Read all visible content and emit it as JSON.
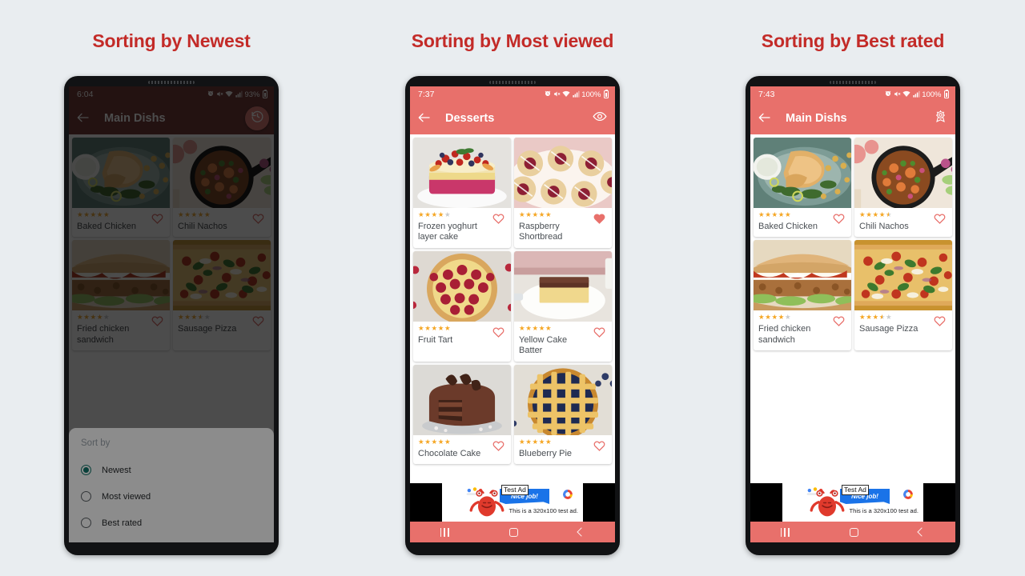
{
  "page": {
    "background": "#e9edf0",
    "heading_color": "#c32b28",
    "accent_coral": "#e8706b",
    "star_color": "#f5a623",
    "heart_color": "#e8706b",
    "radio_selected_color": "#00796b"
  },
  "panels": [
    {
      "caption": "Sorting by Newest",
      "dimmed": true,
      "statusbar": {
        "time": "6:04",
        "icons": [
          "alarm-icon",
          "mute-icon",
          "wifi-icon",
          "signal-icon"
        ],
        "battery": "93%"
      },
      "appbar": {
        "back_icon": "arrow-left-icon",
        "title": "Main Dishs",
        "action_icon": "history-icon",
        "action_is_fab": true
      },
      "cards": [
        {
          "name": "Baked Chicken",
          "rating": 5,
          "favorite": false,
          "image": "baked-chicken-photo"
        },
        {
          "name": "Chili Nachos",
          "rating": 5,
          "favorite": false,
          "image": "chili-nachos-photo"
        },
        {
          "name": "Fried chicken sandwich",
          "rating": 4,
          "favorite": false,
          "image": "fried-chicken-sandwich-photo"
        },
        {
          "name": "Sausage Pizza",
          "rating": 3.5,
          "favorite": false,
          "image": "sausage-pizza-photo"
        }
      ],
      "sheet": {
        "visible": true,
        "title": "Sort by",
        "options": [
          {
            "label": "Newest",
            "selected": true
          },
          {
            "label": "Most viewed",
            "selected": false
          },
          {
            "label": "Best rated",
            "selected": false
          }
        ]
      },
      "ad": {
        "visible": false
      },
      "navbar": {
        "recents_icon": "recents-icon",
        "home_icon": "home-icon",
        "back_icon": "back-icon"
      }
    },
    {
      "caption": "Sorting by Most viewed",
      "dimmed": false,
      "statusbar": {
        "time": "7:37",
        "icons": [
          "alarm-icon",
          "mute-icon",
          "wifi-icon",
          "signal-icon"
        ],
        "battery": "100%"
      },
      "appbar": {
        "back_icon": "arrow-left-icon",
        "title": "Desserts",
        "action_icon": "eye-icon",
        "action_is_fab": false
      },
      "cards": [
        {
          "name": "Frozen yoghurt layer cake",
          "rating": 4,
          "favorite": false,
          "image": "frozen-yoghurt-layer-cake-photo"
        },
        {
          "name": "Raspberry Shortbread",
          "rating": 5,
          "favorite": true,
          "image": "raspberry-shortbread-photo"
        },
        {
          "name": "Fruit Tart",
          "rating": 5,
          "favorite": false,
          "image": "fruit-tart-photo"
        },
        {
          "name": "Yellow Cake Batter",
          "rating": 5,
          "favorite": false,
          "image": "yellow-cake-batter-photo"
        },
        {
          "name": "Chocolate Cake",
          "rating": 5,
          "favorite": false,
          "image": "chocolate-cake-photo"
        },
        {
          "name": "Blueberry Pie",
          "rating": 5,
          "favorite": false,
          "image": "blueberry-pie-photo"
        }
      ],
      "sheet": {
        "visible": false
      },
      "ad": {
        "visible": true,
        "badge": "Test Ad",
        "ribbon": "Nice job!",
        "description": "This is a 320x100 test ad.",
        "logo_icon": "admob-logo-icon",
        "character_icon": "red-monster-icon"
      },
      "navbar": {
        "recents_icon": "recents-icon",
        "home_icon": "home-icon",
        "back_icon": "back-icon"
      }
    },
    {
      "caption": "Sorting by Best rated",
      "dimmed": false,
      "statusbar": {
        "time": "7:43",
        "icons": [
          "alarm-icon",
          "mute-icon",
          "wifi-icon",
          "signal-icon"
        ],
        "battery": "100%"
      },
      "appbar": {
        "back_icon": "arrow-left-icon",
        "title": "Main Dishs",
        "action_icon": "medal-icon",
        "action_is_fab": false
      },
      "cards": [
        {
          "name": "Baked Chicken",
          "rating": 5,
          "favorite": false,
          "image": "baked-chicken-photo"
        },
        {
          "name": "Chili Nachos",
          "rating": 4.5,
          "favorite": false,
          "image": "chili-nachos-photo"
        },
        {
          "name": "Fried chicken sandwich",
          "rating": 4,
          "favorite": false,
          "image": "fried-chicken-sandwich-photo"
        },
        {
          "name": "Sausage Pizza",
          "rating": 3.5,
          "favorite": false,
          "image": "sausage-pizza-photo"
        }
      ],
      "sheet": {
        "visible": false
      },
      "ad": {
        "visible": true,
        "badge": "Test Ad",
        "ribbon": "Nice job!",
        "description": "This is a 320x100 test ad.",
        "logo_icon": "admob-logo-icon",
        "character_icon": "red-monster-icon"
      },
      "navbar": {
        "recents_icon": "recents-icon",
        "home_icon": "home-icon",
        "back_icon": "back-icon"
      }
    }
  ]
}
